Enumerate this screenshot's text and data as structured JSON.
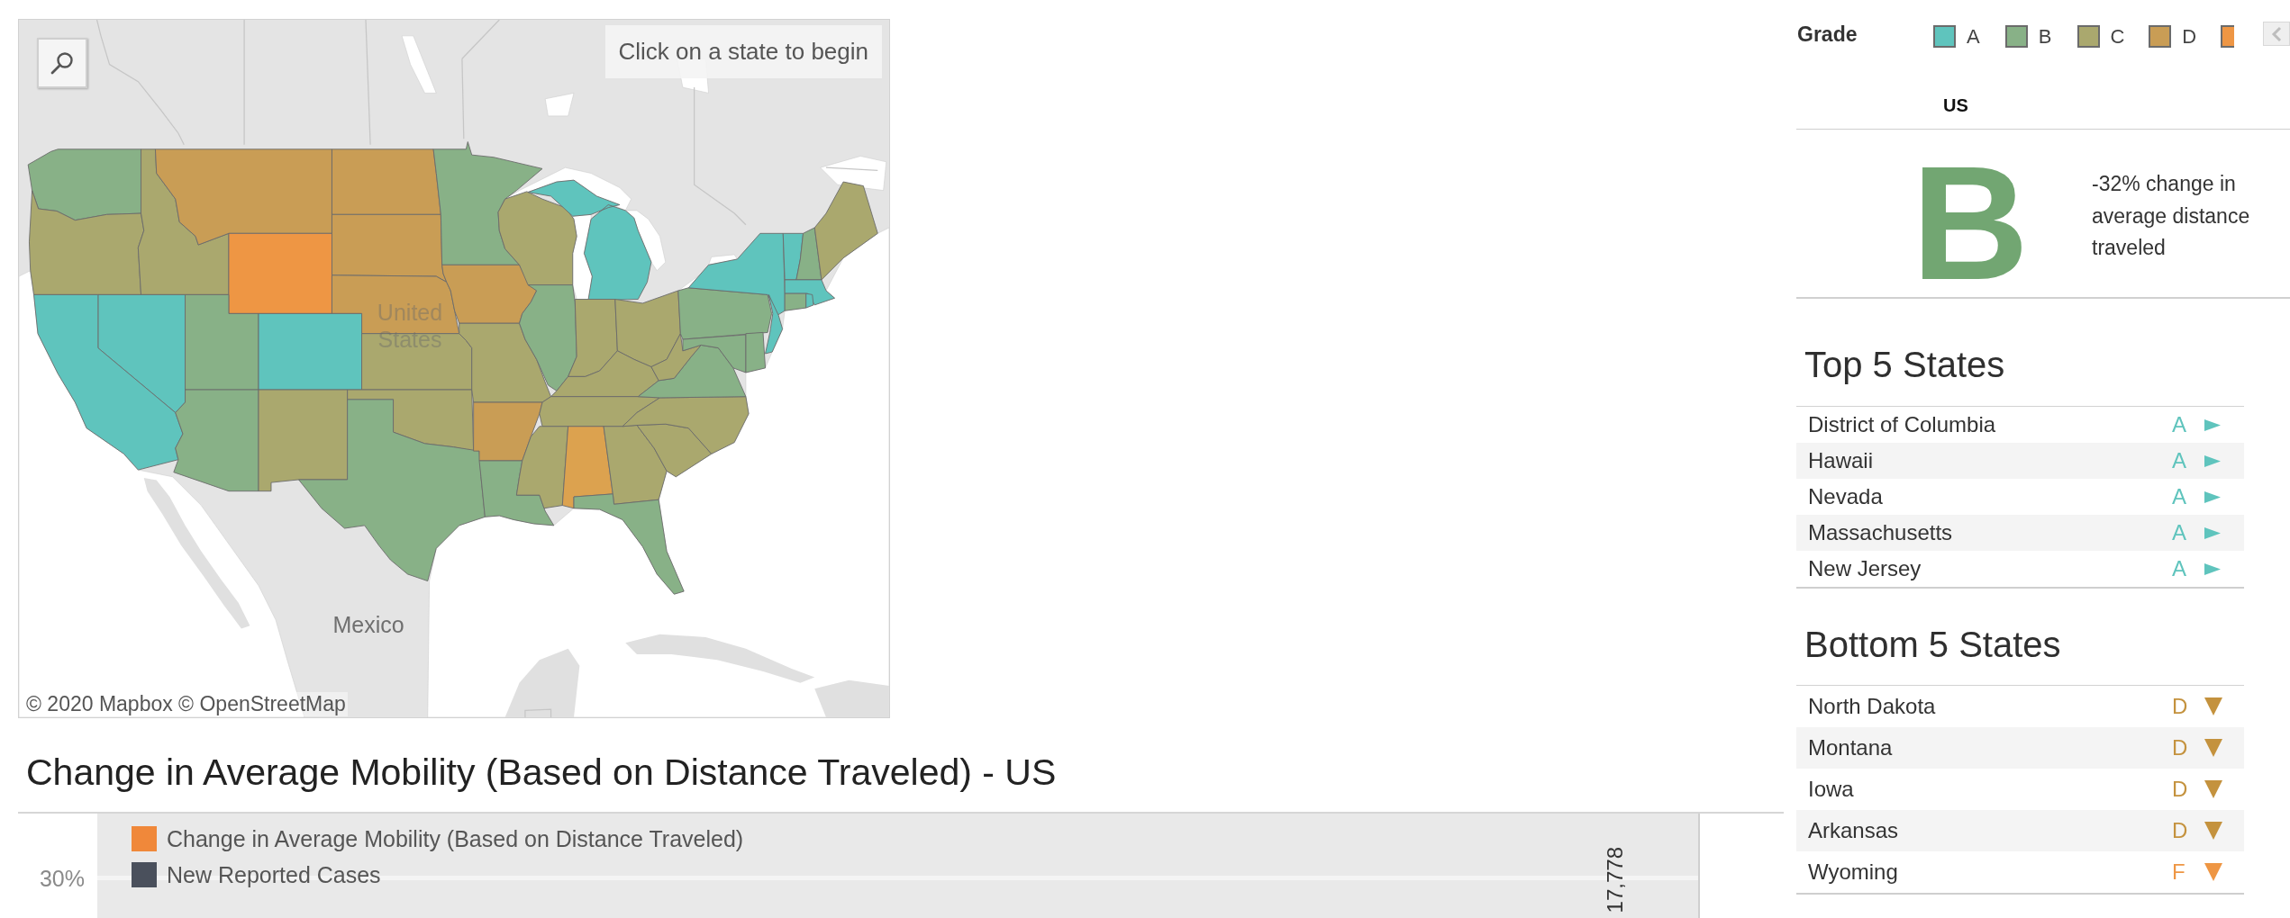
{
  "map": {
    "instruction": "Click on a state to begin",
    "country_labels": [
      "United States",
      "Mexico"
    ],
    "attribution": "© 2020 Mapbox © OpenStreetMap",
    "regions": [
      {
        "color": "#88b187"
      },
      {
        "color": "#aaa86e"
      },
      {
        "color": "#aaa86e"
      },
      {
        "color": "#c99d55"
      },
      {
        "color": "#c99d55"
      },
      {
        "color": "#c99d55"
      },
      {
        "color": "#ee9644"
      },
      {
        "color": "#c99d55"
      },
      {
        "color": "#88b187"
      },
      {
        "color": "#c99d55"
      },
      {
        "color": "#aaa86e"
      },
      {
        "color": "#5fc4bd"
      },
      {
        "color": "#5fc4bd"
      },
      {
        "color": "#5fc4bd"
      },
      {
        "color": "#88b187"
      },
      {
        "color": "#5fc4bd"
      },
      {
        "color": "#88b187"
      },
      {
        "color": "#aaa86e"
      },
      {
        "color": "#aaa86e"
      },
      {
        "color": "#aaa86e"
      },
      {
        "color": "#88b187"
      },
      {
        "color": "#aaa86e"
      },
      {
        "color": "#c99d55"
      },
      {
        "color": "#88b187"
      },
      {
        "color": "#88b187"
      },
      {
        "color": "#aaa86e"
      },
      {
        "color": "#aaa86e"
      },
      {
        "color": "#aaa86e"
      },
      {
        "color": "#aaa86e"
      },
      {
        "color": "#aaa86e"
      },
      {
        "color": "#dca24f"
      },
      {
        "color": "#aaa86e"
      },
      {
        "color": "#88b187"
      },
      {
        "color": "#aaa86e"
      },
      {
        "color": "#aaa86e"
      },
      {
        "color": "#88b187"
      },
      {
        "color": "#aaa86e"
      },
      {
        "color": "#88b187"
      },
      {
        "color": "#5fc4bd"
      },
      {
        "color": "#88b187"
      },
      {
        "color": "#88b187"
      },
      {
        "color": "#5fc4bd"
      },
      {
        "color": "#5fc4bd"
      },
      {
        "color": "#88b187"
      },
      {
        "color": "#aaa86e"
      },
      {
        "color": "#5fc4bd"
      },
      {
        "color": "#88b187"
      },
      {
        "color": "#5fc4bd"
      }
    ]
  },
  "legend": {
    "title": "Grade",
    "items": [
      {
        "label": "A",
        "color": "#5fc4bd"
      },
      {
        "label": "B",
        "color": "#88b187"
      },
      {
        "label": "C",
        "color": "#aaa86e"
      },
      {
        "label": "D",
        "color": "#c99d55"
      },
      {
        "color": "#ee9644"
      }
    ]
  },
  "summary": {
    "region": "US",
    "grade": "B",
    "description": "-32% change in average distance traveled"
  },
  "top_states": {
    "title": "Top 5 States",
    "rows": [
      {
        "name": "District of Columbia",
        "grade": "A",
        "color": "#5fc4bd",
        "kind": "right"
      },
      {
        "name": "Hawaii",
        "grade": "A",
        "color": "#5fc4bd",
        "kind": "right"
      },
      {
        "name": "Nevada",
        "grade": "A",
        "color": "#5fc4bd",
        "kind": "right"
      },
      {
        "name": "Massachusetts",
        "grade": "A",
        "color": "#5fc4bd",
        "kind": "right"
      },
      {
        "name": "New Jersey",
        "grade": "A",
        "color": "#5fc4bd",
        "kind": "right"
      }
    ]
  },
  "bottom_states": {
    "title": "Bottom 5 States",
    "rows": [
      {
        "name": "North Dakota",
        "grade": "D",
        "color": "#c4923e",
        "kind": "down"
      },
      {
        "name": "Montana",
        "grade": "D",
        "color": "#c4923e",
        "kind": "down"
      },
      {
        "name": "Iowa",
        "grade": "D",
        "color": "#c4923e",
        "kind": "down"
      },
      {
        "name": "Arkansas",
        "grade": "D",
        "color": "#c4923e",
        "kind": "down"
      },
      {
        "name": "Wyoming",
        "grade": "F",
        "color": "#ee9644",
        "kind": "down"
      }
    ]
  },
  "chart": {
    "title": "Change in Average Mobility (Based on Distance Traveled) - US",
    "legend": [
      {
        "label": "Change in Average Mobility (Based on Distance Traveled)",
        "color": "#f0883a"
      },
      {
        "label": "New Reported Cases",
        "color": "#4a505c"
      }
    ],
    "y_tick_labels": [
      "30%"
    ],
    "data_labels": [
      "17,778"
    ]
  }
}
